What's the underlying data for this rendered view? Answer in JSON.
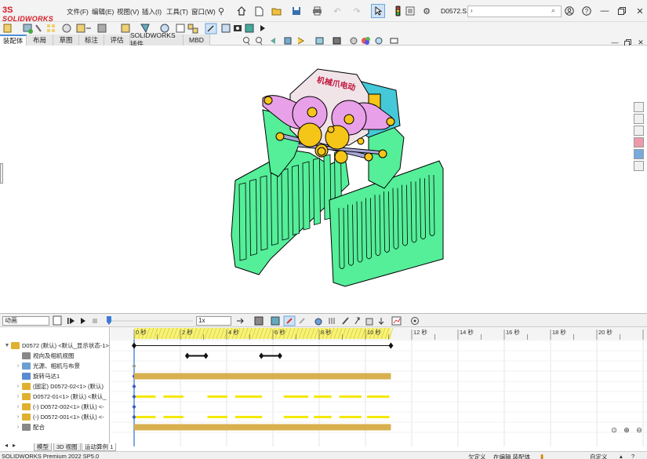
{
  "app": {
    "logo_mark": "3S",
    "logo_text": "SOLIDWORKS",
    "doc_title": "D0572.S...",
    "search_value": "",
    "search_prompt": "›"
  },
  "menu": [
    {
      "label": "文件(F)"
    },
    {
      "label": "编辑(E)"
    },
    {
      "label": "视图(V)"
    },
    {
      "label": "插入(I)"
    },
    {
      "label": "工具(T)"
    },
    {
      "label": "窗口(W)"
    }
  ],
  "tabs": [
    {
      "label": "装配体",
      "active": true
    },
    {
      "label": "布局"
    },
    {
      "label": "草图"
    },
    {
      "label": "标注"
    },
    {
      "label": "评估"
    },
    {
      "label": "SOLIDWORKS 插件"
    },
    {
      "label": "MBD"
    }
  ],
  "model": {
    "label_text": "机械爪电动",
    "colors": {
      "fingers": "#55ee99",
      "links": "#e8a0e8",
      "gears": "#f5c518",
      "body": "#f1e4e8",
      "motor": "#45c8d8",
      "rods": "#a8a8d8"
    }
  },
  "motion": {
    "study_type": "动画",
    "speed": "1x",
    "time_ticks": [
      "0 秒",
      "2 秒",
      "4 秒",
      "6 秒",
      "8 秒",
      "10 秒",
      "12 秒",
      "14 秒",
      "16 秒",
      "18 秒",
      "20 秒"
    ],
    "tree": [
      {
        "label": "D0572 (默认) <默认_显示状态-1>",
        "expand": "▼",
        "indent": 0,
        "icon": "assembly-icon",
        "color": "#e0b030"
      },
      {
        "label": "视向及相机视图",
        "expand": "",
        "indent": 1,
        "icon": "camera-icon",
        "color": "#888888"
      },
      {
        "label": "光源、相机与布景",
        "expand": "›",
        "indent": 1,
        "icon": "lights-icon",
        "color": "#6aa0d0"
      },
      {
        "label": "旋转马达1",
        "expand": "",
        "indent": 1,
        "icon": "motor-icon",
        "color": "#5a8ad0"
      },
      {
        "label": "(固定) D0572-02<1> (默认)",
        "expand": "›",
        "indent": 1,
        "icon": "part-icon",
        "color": "#e0b030"
      },
      {
        "label": "D0572-01<1> (默认) <默认_",
        "expand": "›",
        "indent": 1,
        "icon": "part-icon",
        "color": "#e0b030"
      },
      {
        "label": "(-) D0572-002<1> (默认) <-",
        "expand": "›",
        "indent": 1,
        "icon": "part-icon",
        "color": "#e0b030"
      },
      {
        "label": "(-) D0572-001<1> (默认) <-",
        "expand": "›",
        "indent": 1,
        "icon": "part-icon",
        "color": "#e0b030"
      },
      {
        "label": "配合",
        "expand": "›",
        "indent": 1,
        "icon": "mates-icon",
        "color": "#888888"
      }
    ]
  },
  "bottom_tabs": [
    {
      "label": "模型"
    },
    {
      "label": "3D 视图"
    },
    {
      "label": "运动算例 1",
      "active": true
    }
  ],
  "status": {
    "version": "SOLIDWORKS Premium 2022 SP5.0",
    "undefined": "欠定义",
    "editing": "在编辑 装配体",
    "custom": "自定义"
  }
}
